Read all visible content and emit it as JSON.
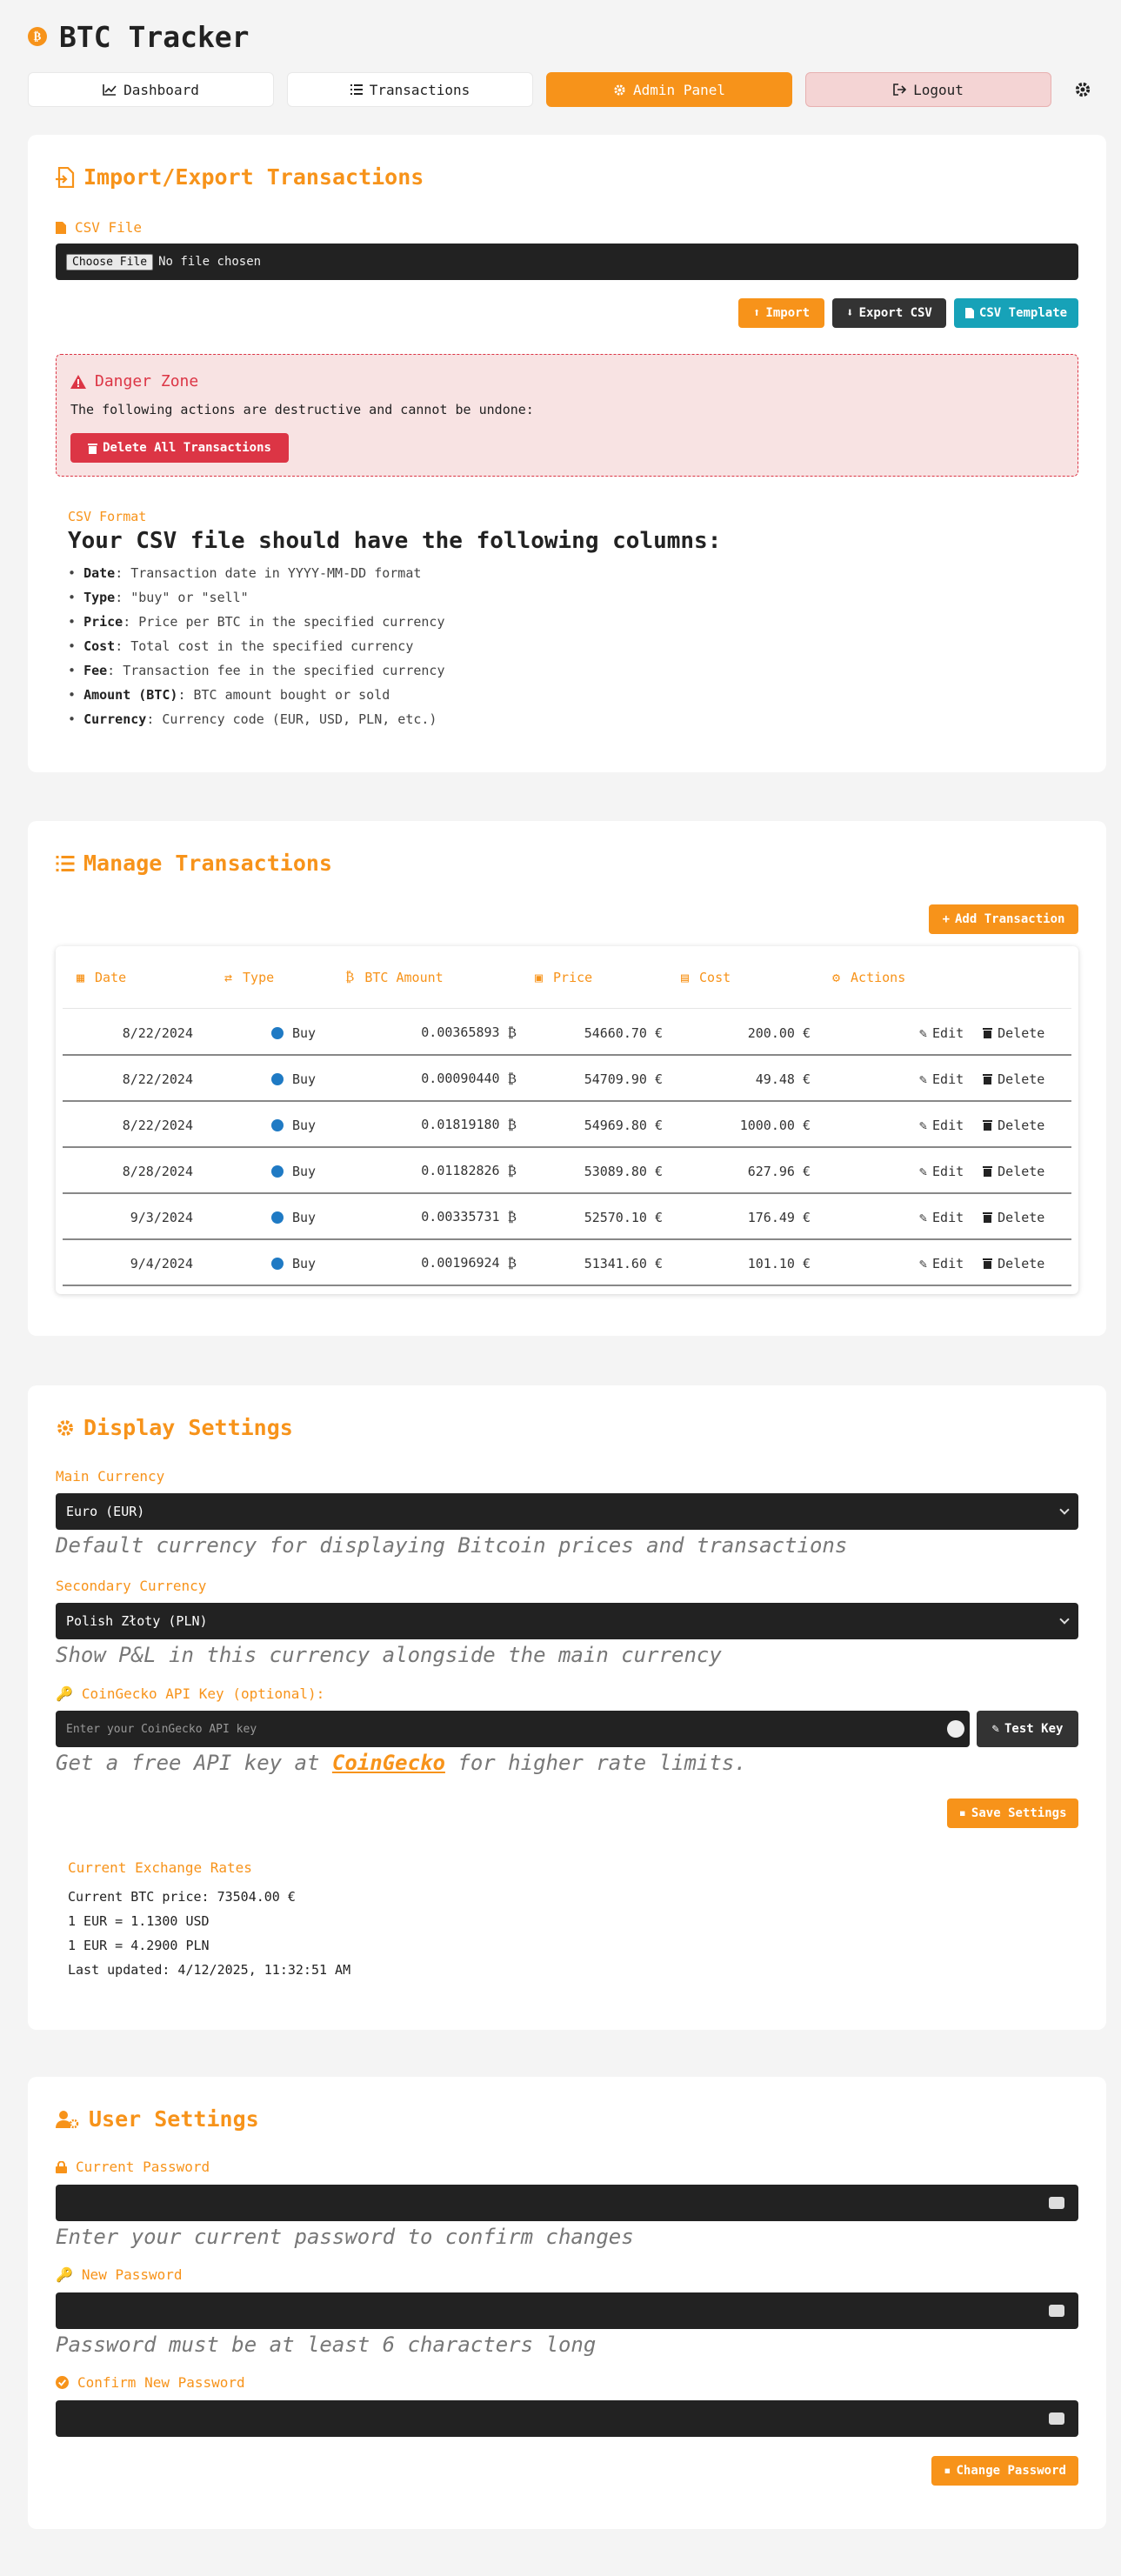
{
  "app": {
    "title": "BTC Tracker",
    "logo_symbol": "₿"
  },
  "nav": {
    "dashboard": "Dashboard",
    "transactions": "Transactions",
    "admin": "Admin Panel",
    "logout": "Logout"
  },
  "import_export": {
    "title": "Import/Export Transactions",
    "csv_file_label": "CSV File",
    "file_button": "Choose File",
    "file_status": "No file chosen",
    "import_btn": "Import",
    "export_btn": "Export CSV",
    "template_btn": "CSV Template",
    "danger_title": "Danger Zone",
    "danger_text": "The following actions are destructive and cannot be undone:",
    "delete_all_btn": "Delete All Transactions",
    "format_small": "CSV Format",
    "format_heading": "Your CSV file should have the following columns:",
    "columns": [
      {
        "name": "Date",
        "desc": "Transaction date in YYYY-MM-DD format"
      },
      {
        "name": "Type",
        "desc": "\"buy\" or \"sell\""
      },
      {
        "name": "Price",
        "desc": "Price per BTC in the specified currency"
      },
      {
        "name": "Cost",
        "desc": "Total cost in the specified currency"
      },
      {
        "name": "Fee",
        "desc": "Transaction fee in the specified currency"
      },
      {
        "name": "Amount (BTC)",
        "desc": "BTC amount bought or sold"
      },
      {
        "name": "Currency",
        "desc": "Currency code (EUR, USD, PLN, etc.)"
      }
    ]
  },
  "manage": {
    "title": "Manage Transactions",
    "add_btn": "Add Transaction",
    "headers": {
      "date": "Date",
      "type": "Type",
      "amount": "BTC Amount",
      "price": "Price",
      "cost": "Cost",
      "actions": "Actions"
    },
    "edit_label": "Edit",
    "delete_label": "Delete",
    "rows": [
      {
        "date": "8/22/2024",
        "type": "Buy",
        "amount": "0.00365893 ₿",
        "price": "54660.70 €",
        "cost": "200.00 €"
      },
      {
        "date": "8/22/2024",
        "type": "Buy",
        "amount": "0.00090440 ₿",
        "price": "54709.90 €",
        "cost": "49.48 €"
      },
      {
        "date": "8/22/2024",
        "type": "Buy",
        "amount": "0.01819180 ₿",
        "price": "54969.80 €",
        "cost": "1000.00 €"
      },
      {
        "date": "8/28/2024",
        "type": "Buy",
        "amount": "0.01182826 ₿",
        "price": "53089.80 €",
        "cost": "627.96 €"
      },
      {
        "date": "9/3/2024",
        "type": "Buy",
        "amount": "0.00335731 ₿",
        "price": "52570.10 €",
        "cost": "176.49 €"
      },
      {
        "date": "9/4/2024",
        "type": "Buy",
        "amount": "0.00196924 ₿",
        "price": "51341.60 €",
        "cost": "101.10 €"
      }
    ]
  },
  "display": {
    "title": "Display Settings",
    "main_currency_label": "Main Currency",
    "main_currency_value": "Euro (EUR)",
    "main_currency_help": "Default currency for displaying Bitcoin prices and transactions",
    "secondary_currency_label": "Secondary Currency",
    "secondary_currency_value": "Polish Złoty (PLN)",
    "secondary_currency_help": "Show P&L in this currency alongside the main currency",
    "api_key_label": "CoinGecko API Key (optional):",
    "api_key_placeholder": "Enter your CoinGecko API key",
    "test_key_btn": "Test Key",
    "api_help_prefix": "Get a free API key at ",
    "api_help_link": "CoinGecko",
    "api_help_suffix": " for higher rate limits.",
    "save_btn": "Save Settings",
    "rates_title": "Current Exchange Rates",
    "btc_price": "Current BTC price: 73504.00 €",
    "rate_usd": "1 EUR = 1.1300 USD",
    "rate_pln": "1 EUR = 4.2900 PLN",
    "last_updated": "Last updated: 4/12/2025, 11:32:51 AM"
  },
  "user": {
    "title": "User Settings",
    "current_pw_label": "Current Password",
    "current_pw_help": "Enter your current password to confirm changes",
    "new_pw_label": "New Password",
    "new_pw_help": "Password must be at least 6 characters long",
    "confirm_pw_label": "Confirm New Password",
    "change_btn": "Change Password"
  },
  "colors": {
    "accent": "#f7931a",
    "danger": "#dc3545",
    "info": "#17a2b8",
    "dark_field": "#222222"
  }
}
